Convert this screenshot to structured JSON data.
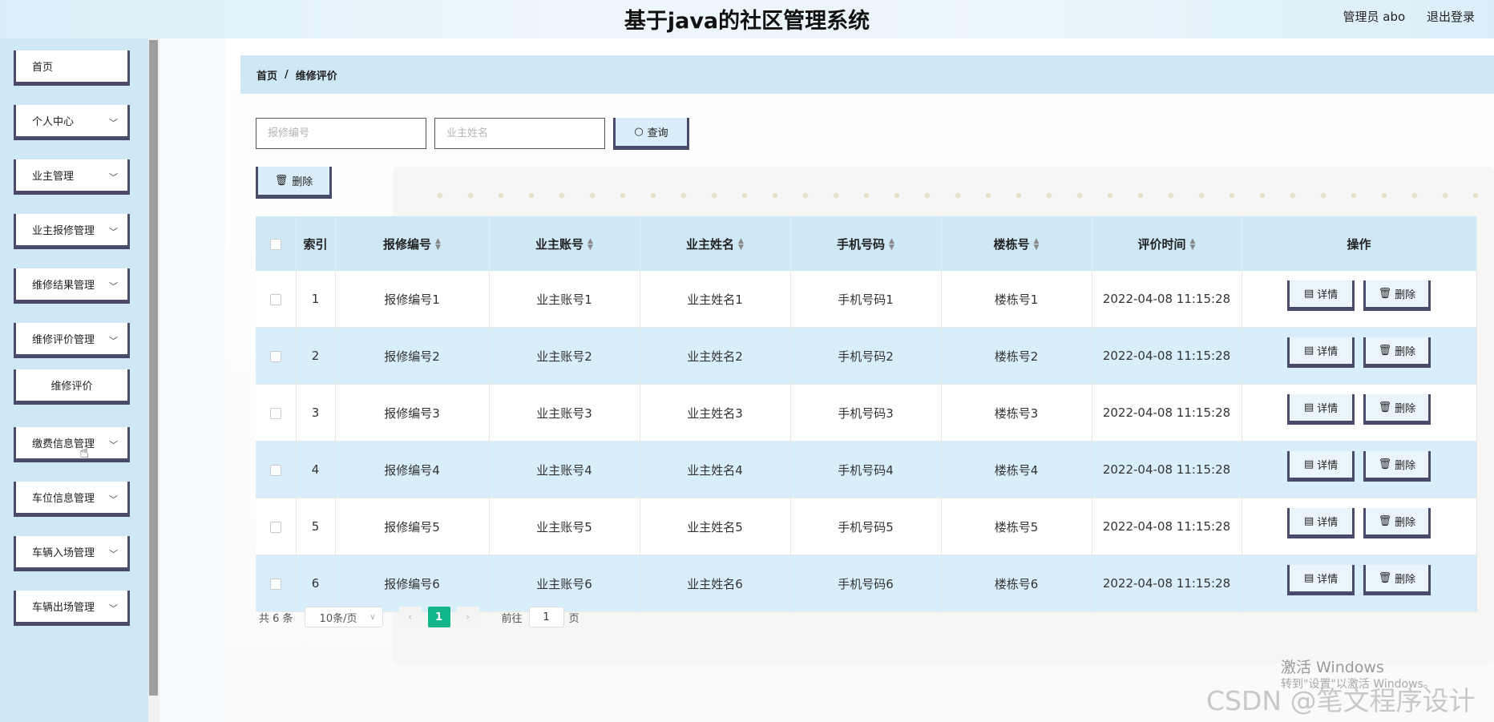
{
  "header": {
    "title": "基于java的社区管理系统",
    "user_label": "管理员 abo",
    "logout_label": "退出登录"
  },
  "sidebar": {
    "items": [
      {
        "label": "首页",
        "has_arrow": false
      },
      {
        "label": "个人中心",
        "has_arrow": true
      },
      {
        "label": "业主管理",
        "has_arrow": true
      },
      {
        "label": "业主报修管理",
        "has_arrow": true
      },
      {
        "label": "维修结果管理",
        "has_arrow": true
      },
      {
        "label": "维修评价管理",
        "has_arrow": true
      },
      {
        "label": "维修评价",
        "has_arrow": false,
        "submenu": true
      },
      {
        "label": "缴费信息管理",
        "has_arrow": true
      },
      {
        "label": "车位信息管理",
        "has_arrow": true
      },
      {
        "label": "车辆入场管理",
        "has_arrow": true
      },
      {
        "label": "车辆出场管理",
        "has_arrow": true
      }
    ]
  },
  "breadcrumb": {
    "home": "首页",
    "separator": "/",
    "current": "维修评价"
  },
  "search": {
    "repair_no_placeholder": "报修编号",
    "owner_name_placeholder": "业主姓名",
    "query_label": "查询"
  },
  "toolbar": {
    "delete_label": "删除"
  },
  "table": {
    "columns": [
      "索引",
      "报修编号",
      "业主账号",
      "业主姓名",
      "手机号码",
      "楼栋号",
      "评价时间",
      "操作"
    ],
    "rows": [
      {
        "index": "1",
        "repair_no": "报修编号1",
        "account": "业主账号1",
        "name": "业主姓名1",
        "phone": "手机号码1",
        "building": "楼栋号1",
        "time": "2022-04-08 11:15:28"
      },
      {
        "index": "2",
        "repair_no": "报修编号2",
        "account": "业主账号2",
        "name": "业主姓名2",
        "phone": "手机号码2",
        "building": "楼栋号2",
        "time": "2022-04-08 11:15:28"
      },
      {
        "index": "3",
        "repair_no": "报修编号3",
        "account": "业主账号3",
        "name": "业主姓名3",
        "phone": "手机号码3",
        "building": "楼栋号3",
        "time": "2022-04-08 11:15:28"
      },
      {
        "index": "4",
        "repair_no": "报修编号4",
        "account": "业主账号4",
        "name": "业主姓名4",
        "phone": "手机号码4",
        "building": "楼栋号4",
        "time": "2022-04-08 11:15:28"
      },
      {
        "index": "5",
        "repair_no": "报修编号5",
        "account": "业主账号5",
        "name": "业主姓名5",
        "phone": "手机号码5",
        "building": "楼栋号5",
        "time": "2022-04-08 11:15:28"
      },
      {
        "index": "6",
        "repair_no": "报修编号6",
        "account": "业主账号6",
        "name": "业主姓名6",
        "phone": "手机号码6",
        "building": "楼栋号6",
        "time": "2022-04-08 11:15:28"
      }
    ],
    "detail_label": "详情",
    "row_delete_label": "删除"
  },
  "pagination": {
    "total_text": "共 6 条",
    "page_size": "10条/页",
    "current_page": "1",
    "goto_prefix": "前往",
    "goto_value": "1",
    "goto_suffix": "页"
  },
  "watermark": {
    "activate_line1": "激活 Windows",
    "activate_line2": "转到\"设置\"以激活 Windows。",
    "csdn": "CSDN @笔文程序设计"
  },
  "icons": {
    "chevron": "chevron-down-icon",
    "search": "search-icon",
    "trash": "trash-icon",
    "document": "document-icon",
    "cursor": "hand-cursor-icon"
  },
  "colors": {
    "header_bg": "#dbeef8",
    "sidebar_bg": "#cfe8f5",
    "table_header_bg": "#cfe8f5",
    "row_alt_bg": "#d8eefa",
    "button_border": "#4a4a6a",
    "pagination_active": "#13b58b"
  }
}
